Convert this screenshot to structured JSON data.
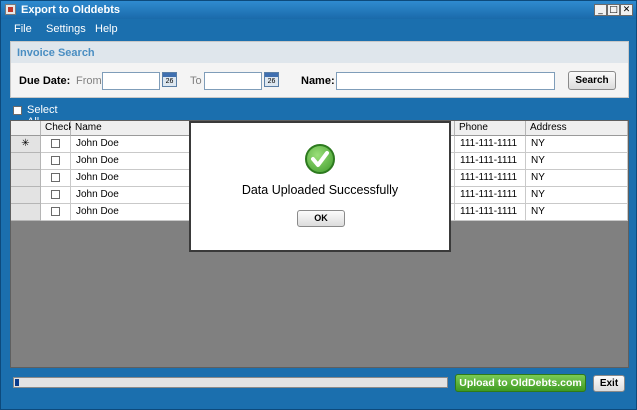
{
  "window": {
    "title": "Export to Olddebts"
  },
  "menu": [
    "File",
    "Settings",
    "Help"
  ],
  "search": {
    "title": "Invoice Search",
    "due_date_label": "Due Date:",
    "from_label": "From",
    "to_label": "To",
    "name_label": "Name:",
    "from_value": "",
    "to_value": "",
    "name_value": "",
    "calendar_day": "26",
    "search_button": "Search"
  },
  "select_all_label": "Select All",
  "grid": {
    "columns": [
      "",
      "Check",
      "Name",
      "Phone",
      "Address"
    ],
    "current_row_marker": "✳",
    "rows": [
      {
        "name": "John Doe",
        "phone": "111-111-1111",
        "address": "NY"
      },
      {
        "name": "John Doe",
        "phone": "111-111-1111",
        "address": "NY"
      },
      {
        "name": "John Doe",
        "phone": "111-111-1111",
        "address": "NY"
      },
      {
        "name": "John Doe",
        "phone": "111-111-1111",
        "address": "NY"
      },
      {
        "name": "John Doe",
        "phone": "111-111-1111",
        "address": "NY"
      }
    ]
  },
  "dialog": {
    "message": "Data Uploaded Successfully",
    "ok_label": "OK"
  },
  "footer": {
    "progress_fraction": 0.01,
    "upload_button": "Upload to OldDebts.com",
    "exit_button": "Exit"
  },
  "colors": {
    "window": "#1b6fae",
    "accent_green": "#3f9a22",
    "panel_title": "#4a8ec2"
  }
}
